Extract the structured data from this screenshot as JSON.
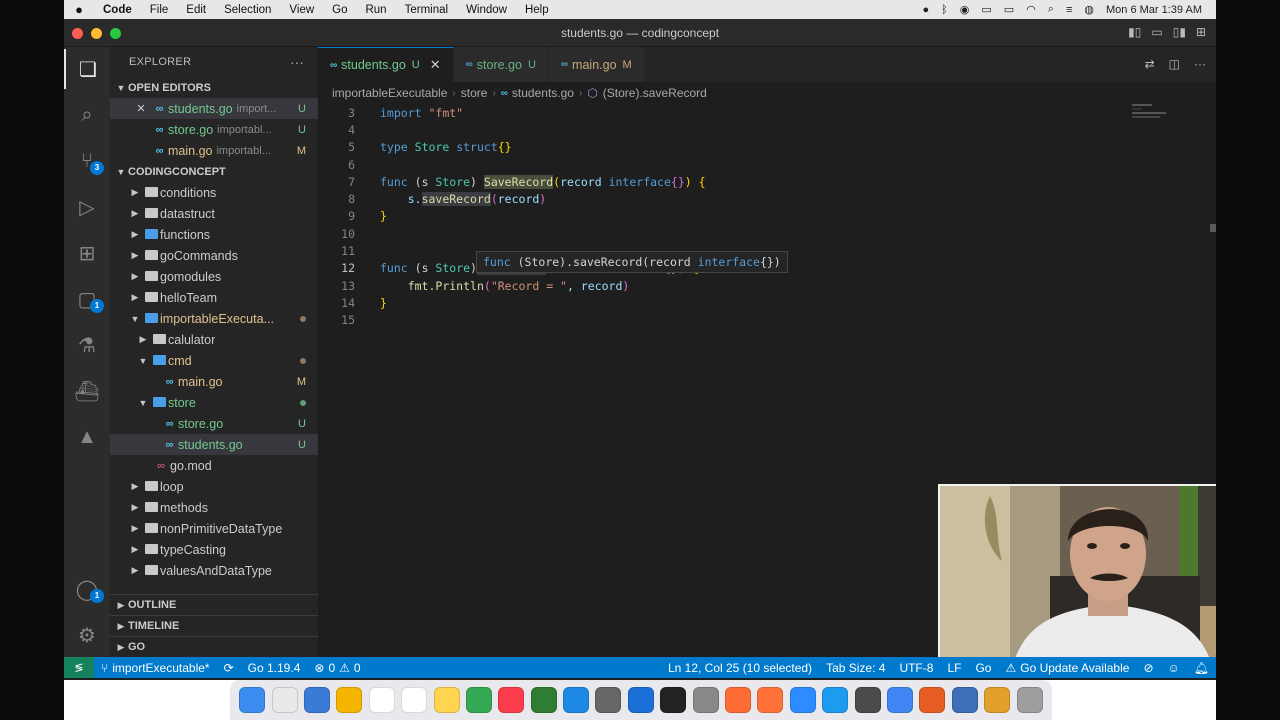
{
  "menubar": {
    "app": "Code",
    "items": [
      "File",
      "Edit",
      "Selection",
      "View",
      "Go",
      "Run",
      "Terminal",
      "Window",
      "Help"
    ],
    "clock": "Mon 6 Mar  1:39 AM"
  },
  "window": {
    "title": "students.go — codingconcept"
  },
  "activity_bar": {
    "scm_badge": "3",
    "remote_badge": "1",
    "accounts_badge": "1"
  },
  "sidebar": {
    "title": "EXPLORER",
    "more": "···",
    "open_editors": {
      "label": "OPEN EDITORS",
      "items": [
        {
          "name": "students.go",
          "desc": "import...",
          "status": "U",
          "close": "✕"
        },
        {
          "name": "store.go",
          "desc": "importabl...",
          "status": "U"
        },
        {
          "name": "main.go",
          "desc": "importabl...",
          "status": "M"
        }
      ]
    },
    "workspace": {
      "label": "CODINGCONCEPT",
      "folders": [
        "conditions",
        "datastruct",
        "functions",
        "goCommands",
        "gomodules",
        "helloTeam"
      ],
      "importable": "importableExecuta...",
      "calulator": "calulator",
      "cmd": "cmd",
      "cmd_main": "main.go",
      "cmd_main_status": "M",
      "store": "store",
      "store_go": "store.go",
      "store_go_status": "U",
      "students_go": "students.go",
      "students_go_status": "U",
      "go_mod": "go.mod",
      "folders_after": [
        "loop",
        "methods",
        "nonPrimitiveDataType",
        "typeCasting",
        "valuesAndDataType"
      ]
    },
    "outline": "OUTLINE",
    "timeline": "TIMELINE",
    "go": "GO"
  },
  "tabs": [
    {
      "name": "students.go",
      "status": "U",
      "close": "✕"
    },
    {
      "name": "store.go",
      "status": "U"
    },
    {
      "name": "main.go",
      "status": "M"
    }
  ],
  "breadcrumb": [
    "importableExecutable",
    "store",
    "students.go",
    "(Store).saveRecord"
  ],
  "code": {
    "line_numbers": [
      "3",
      "4",
      "5",
      "6",
      "7",
      "8",
      "9",
      "10",
      "11",
      "12",
      "13",
      "14",
      "15"
    ],
    "import_kw": "import",
    "import_str": "\"fmt\"",
    "type_kw": "type",
    "store_type": "Store",
    "struct_kw": "struct",
    "func_kw": "func",
    "recv_open": "(s ",
    "recv_close": ") ",
    "save_upper": "SaveRecord",
    "save_lower": "saveRecord",
    "param": "record",
    "iface": "interface",
    "s_dot": "s.",
    "fmt_println": "fmt.Println",
    "record_str": "\"Record = \"",
    "record_arg": ", record"
  },
  "hover": {
    "func_kw": "func",
    "signature": " (Store).saveRecord(record ",
    "iface": "interface",
    "tail": "{})"
  },
  "statusbar": {
    "branch": "importExecutable*",
    "go_version": "Go 1.19.4",
    "errors": "0",
    "warnings": "0",
    "position": "Ln 12, Col 25 (10 selected)",
    "tab_size": "Tab Size: 4",
    "encoding": "UTF-8",
    "eol": "LF",
    "language": "Go",
    "update": "Go Update Available"
  },
  "dock": {
    "colors": [
      "#3c8df0",
      "#e9e9e9",
      "#3a7bd5",
      "#f4b400",
      "#ffffff",
      "#ffffff",
      "#ffd54f",
      "#34a853",
      "#fa3c4c",
      "#2e7d32",
      "#1e88e5",
      "#666666",
      "#1c6fd6",
      "#222222",
      "#888888",
      "#ff6b35",
      "#ff7139",
      "#2d8cff",
      "#1d9bf0",
      "#4a4a4a",
      "#4285f4",
      "#e85d24",
      "#3d6fb6",
      "#e2a12b",
      "#9e9e9e"
    ]
  }
}
